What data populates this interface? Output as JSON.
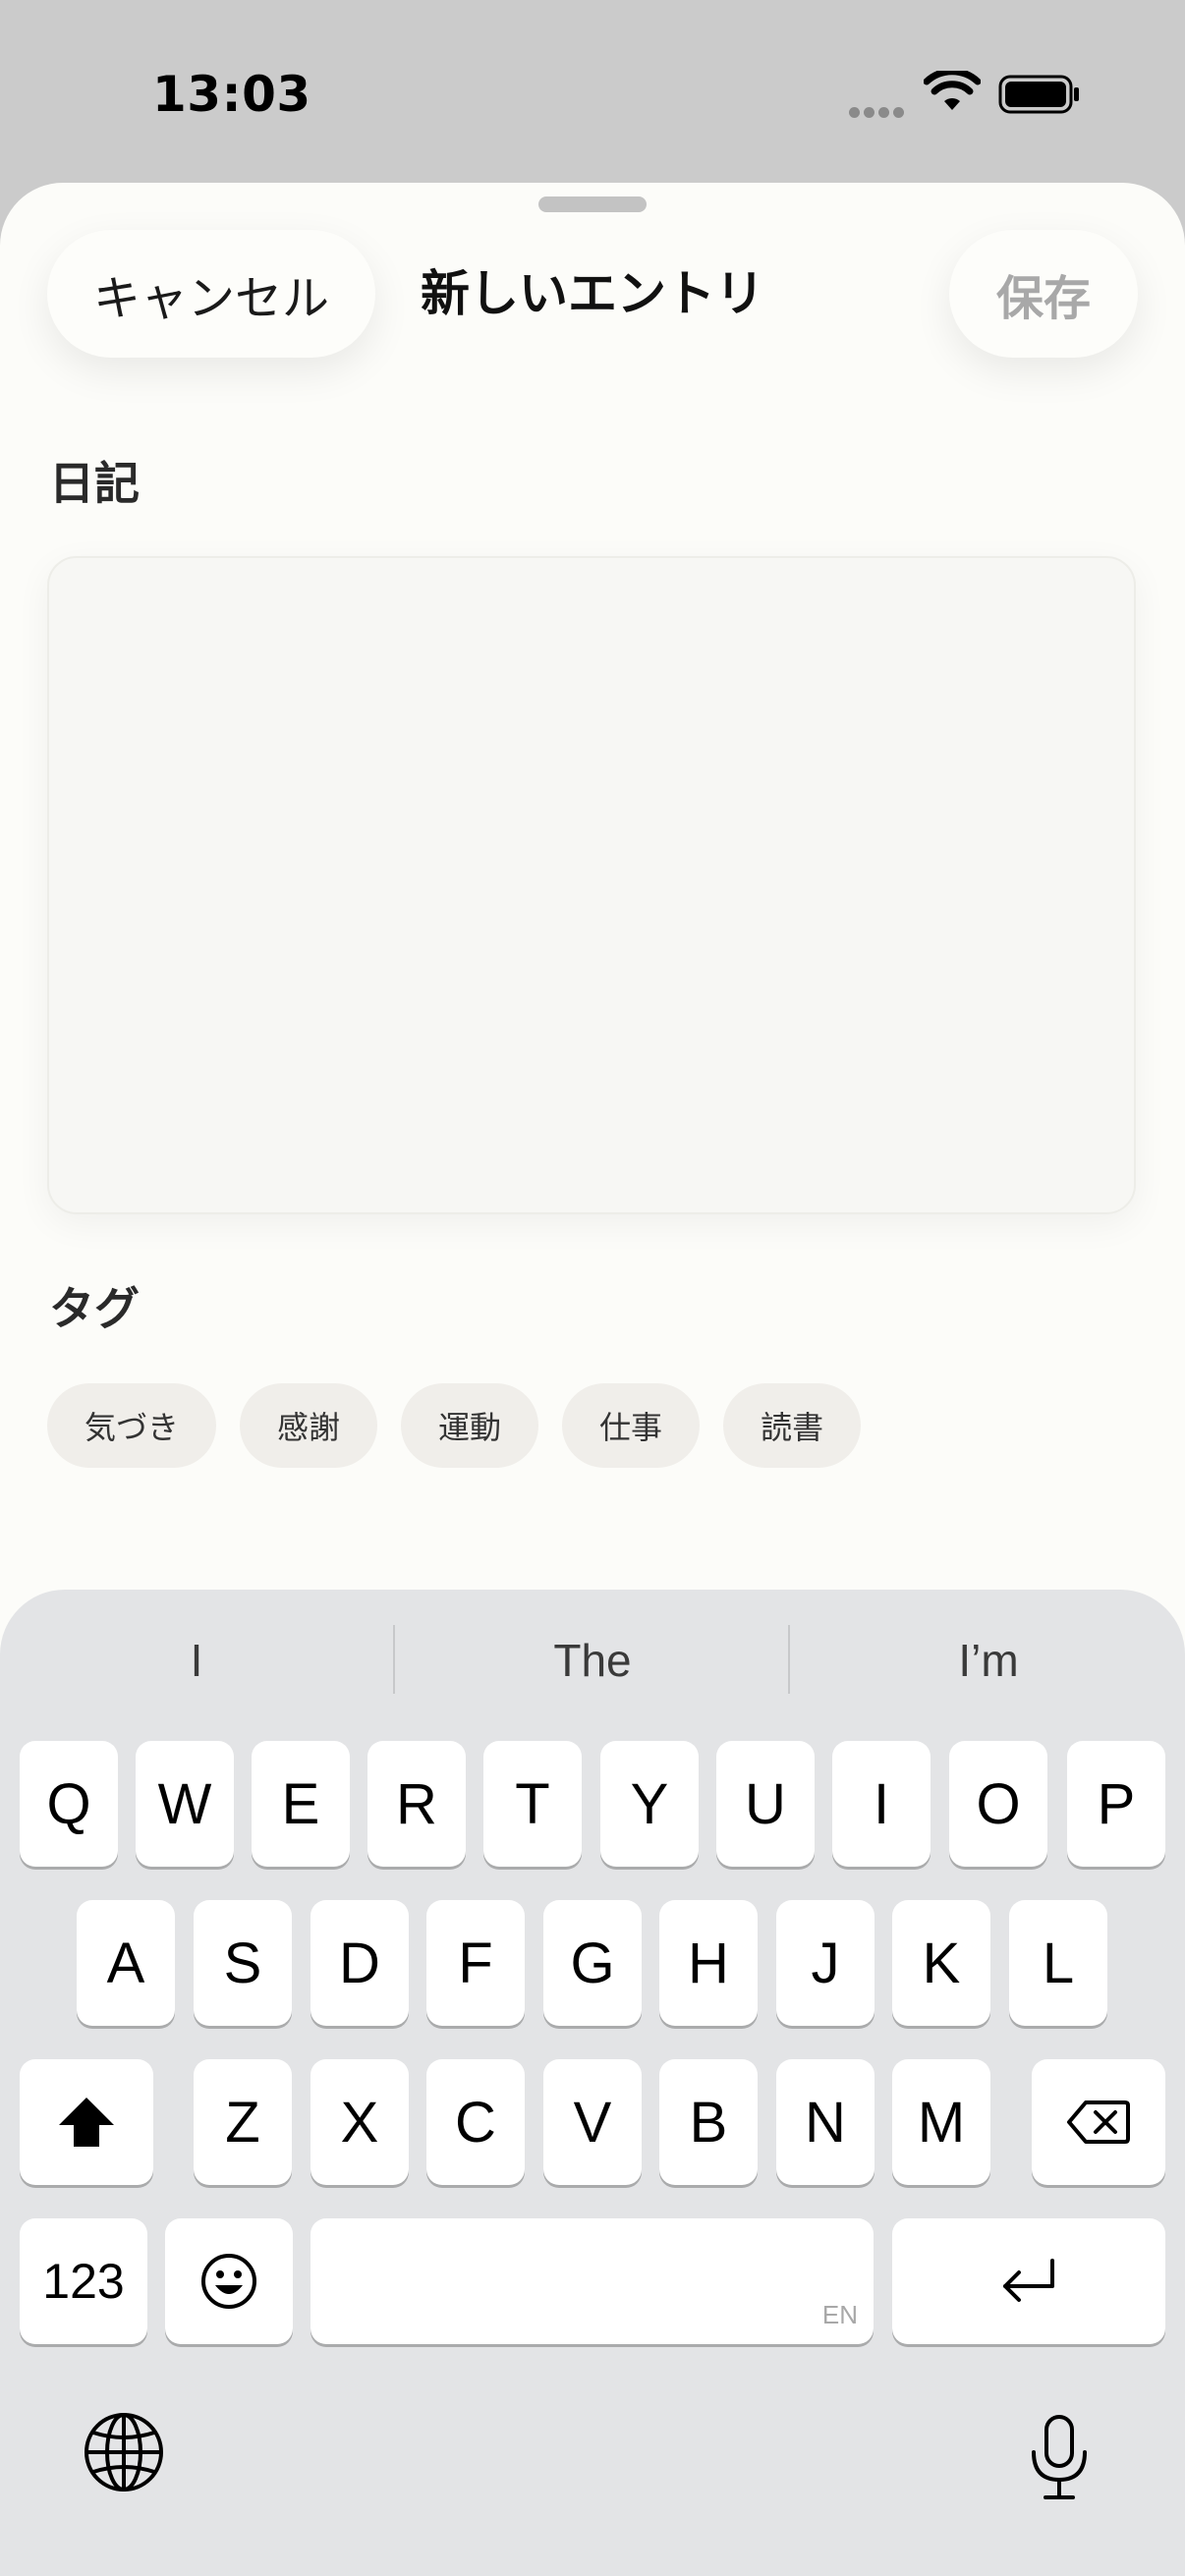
{
  "status_bar": {
    "time": "13:03",
    "icons": [
      "signal-dots-icon",
      "wifi-icon",
      "battery-icon"
    ]
  },
  "sheet": {
    "cancel_label": "キャンセル",
    "title": "新しいエントリ",
    "save_label": "保存",
    "diary_label": "日記",
    "journal_value": "",
    "tags_label": "タグ",
    "tags": [
      "気づき",
      "感謝",
      "運動",
      "仕事",
      "読書"
    ]
  },
  "keyboard": {
    "suggestions": [
      "I",
      "The",
      "I’m"
    ],
    "row1": [
      "Q",
      "W",
      "E",
      "R",
      "T",
      "Y",
      "U",
      "I",
      "O",
      "P"
    ],
    "row2": [
      "A",
      "S",
      "D",
      "F",
      "G",
      "H",
      "J",
      "K",
      "L"
    ],
    "row3": [
      "Z",
      "X",
      "C",
      "V",
      "B",
      "N",
      "M"
    ],
    "numbers_label": "123",
    "space_hint": "EN",
    "icons": [
      "shift-icon",
      "backspace-icon",
      "emoji-icon",
      "return-icon",
      "globe-icon",
      "microphone-icon"
    ]
  },
  "colors": {
    "status_bar_bg": "#CBCBCB",
    "sheet_bg": "#FCFCF9",
    "keyboard_bg": "#E3E4E6",
    "disabled_text": "#A8A8A8",
    "tag_bg": "#F0EEEA"
  }
}
